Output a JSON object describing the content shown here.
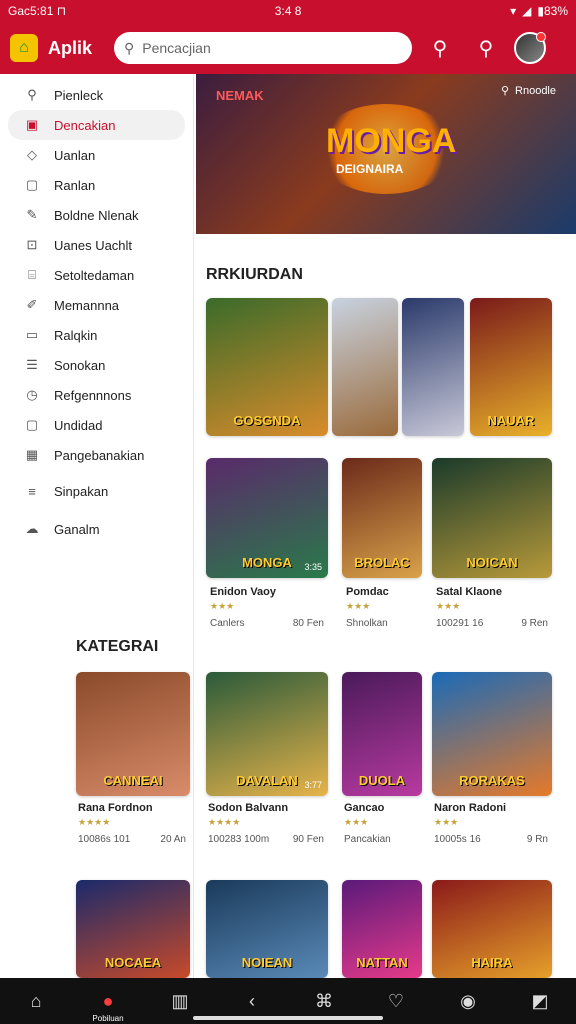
{
  "status": {
    "left": "Gac5:81 ⊓",
    "center": "3:4 8",
    "right": "▮83%"
  },
  "appbar": {
    "title": "Aplik",
    "search_placeholder": "Pencacjian"
  },
  "sidebar": {
    "items": [
      {
        "label": "Pienleck",
        "icon": "search-icon"
      },
      {
        "label": "Dencakian",
        "icon": "app-icon"
      },
      {
        "label": "Uanlan",
        "icon": "diamond-icon"
      },
      {
        "label": "Ranlan",
        "icon": "square-icon"
      },
      {
        "label": "Boldne Nlenak",
        "icon": "pen-icon"
      },
      {
        "label": "Uanes Uachlt",
        "icon": "grid-icon"
      },
      {
        "label": "Setoltedaman",
        "icon": "bag-icon"
      },
      {
        "label": "Memannna",
        "icon": "pencil-icon"
      },
      {
        "label": "Ralqkin",
        "icon": "chat-icon"
      },
      {
        "label": "Sonokan",
        "icon": "list-icon"
      },
      {
        "label": "Refgennnons",
        "icon": "clock-icon"
      },
      {
        "label": "Undidad",
        "icon": "box-icon"
      },
      {
        "label": "Pangebanakian",
        "icon": "calendar-icon"
      },
      {
        "label": "Sinpakan",
        "icon": "menu-icon"
      },
      {
        "label": "Ganalm",
        "icon": "cloud-icon"
      }
    ]
  },
  "hero": {
    "brand": "NEMAK",
    "title": "MONGA",
    "subtitle": "DEIGNAIRA",
    "search_tag": "Rnoodle"
  },
  "sections": {
    "featured_title": "RRKIURDAN",
    "featured_more": "⊳ ⊳ ⊳",
    "categories_title": "KATEGRAI"
  },
  "featured": [
    {
      "label": "GOSGNDA",
      "num": "",
      "colors": [
        "#3a6b2a",
        "#d98c2b"
      ]
    },
    {
      "label": "",
      "num": "",
      "colors": [
        "#c8d2e0",
        "#9a6a3a"
      ]
    },
    {
      "label": "",
      "num": "",
      "colors": [
        "#2a3a6b",
        "#c8c8d8"
      ]
    },
    {
      "label": "NAUAR",
      "num": "",
      "colors": [
        "#7a1a1a",
        "#e9b12a"
      ]
    }
  ],
  "row2": [
    {
      "label": "MONGA",
      "num": "3:35",
      "name": "Enidon Vaoy",
      "stars": "★★★",
      "left": "Canlers",
      "right": "80 Fen",
      "colors": [
        "#5a2a6b",
        "#2a7a4a"
      ]
    },
    {
      "label": "BROLAC",
      "num": "",
      "name": "Pomdac",
      "stars": "★★★",
      "left": "Shnolkan",
      "right": "",
      "colors": [
        "#6b2a1a",
        "#d9a24a"
      ]
    },
    {
      "label": "NOICAN",
      "num": "",
      "name": "Satal Klaone",
      "stars": "★★★",
      "left": "100291 16",
      "right": "9 Ren",
      "colors": [
        "#1a3a2a",
        "#b89a3a"
      ]
    }
  ],
  "row3": [
    {
      "label": "CANNEAI",
      "num": "",
      "name": "Rana Fordnon",
      "stars": "★★★★",
      "left": "10086s 101",
      "right": "20 An",
      "colors": [
        "#8a4a2a",
        "#d98c6a"
      ]
    },
    {
      "label": "DAVALAN",
      "num": "3:77",
      "name": "Sodon Balvann",
      "stars": "★★★★",
      "left": "100283 100m",
      "right": "90 Fen",
      "colors": [
        "#2a5a3a",
        "#e6b34a"
      ]
    },
    {
      "label": "DUOLA",
      "num": "",
      "name": "Gancao",
      "stars": "★★★",
      "left": "Pancakian",
      "right": "",
      "colors": [
        "#4a1a5a",
        "#b83aa0"
      ]
    },
    {
      "label": "RORAKAS",
      "num": "",
      "name": "Naron Radoni",
      "stars": "★★★",
      "left": "10005s 16",
      "right": "9 Rn",
      "colors": [
        "#1a6ab8",
        "#e67a2a"
      ]
    }
  ],
  "row4": [
    {
      "label": "NOCAEA",
      "colors": [
        "#1a2a6b",
        "#c84a2a"
      ]
    },
    {
      "label": "NOIEAN",
      "colors": [
        "#1a3a5a",
        "#5a8ab8"
      ]
    },
    {
      "label": "NATTAN",
      "colors": [
        "#5a1a7a",
        "#e63a8a"
      ]
    },
    {
      "label": "HAIRA",
      "colors": [
        "#8a1a1a",
        "#e6a02a"
      ]
    }
  ],
  "bottomnav": [
    "home-icon",
    "pin-icon",
    "book-icon",
    "back-icon",
    "gamepad-icon",
    "heart-icon",
    "record-icon",
    "edit-icon"
  ],
  "bottomnav_label": "Pobiluan"
}
